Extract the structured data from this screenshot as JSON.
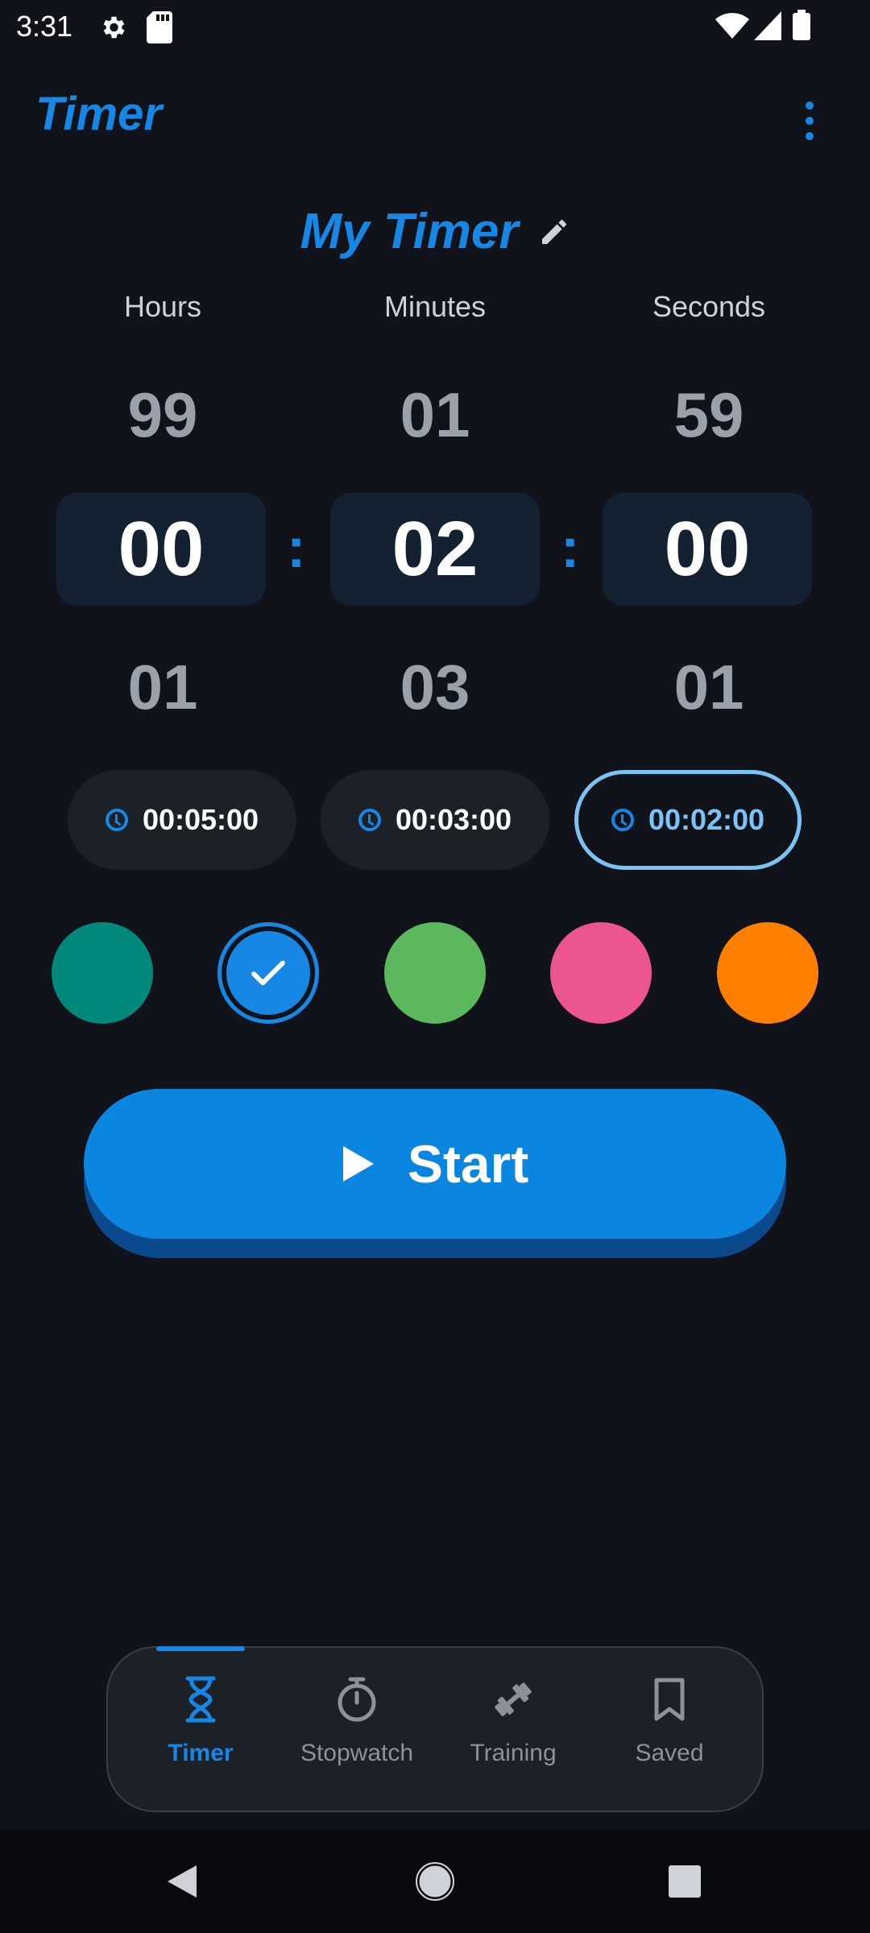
{
  "status_bar": {
    "time": "3:31"
  },
  "app_bar": {
    "title": "Timer"
  },
  "timer_name": "My Timer",
  "columns": [
    {
      "label": "Hours",
      "above": "99",
      "value": "00",
      "below": "01"
    },
    {
      "label": "Minutes",
      "above": "01",
      "value": "02",
      "below": "03"
    },
    {
      "label": "Seconds",
      "above": "59",
      "value": "00",
      "below": "01"
    }
  ],
  "separator": ":",
  "presets": [
    {
      "label": "00:05:00",
      "selected": false
    },
    {
      "label": "00:03:00",
      "selected": false
    },
    {
      "label": "00:02:00",
      "selected": true
    }
  ],
  "colors": [
    {
      "hex": "#00897b",
      "selected": false
    },
    {
      "hex": "#1787e6",
      "selected": true
    },
    {
      "hex": "#5cb85c",
      "selected": false
    },
    {
      "hex": "#ec5592",
      "selected": false
    },
    {
      "hex": "#ff8000",
      "selected": false
    }
  ],
  "start_button": {
    "label": "Start"
  },
  "bottom_nav": [
    {
      "label": "Timer",
      "icon": "hourglass-icon",
      "active": true
    },
    {
      "label": "Stopwatch",
      "icon": "stopwatch-icon",
      "active": false
    },
    {
      "label": "Training",
      "icon": "dumbbell-icon",
      "active": false
    },
    {
      "label": "Saved",
      "icon": "bookmark-icon",
      "active": false
    }
  ],
  "accent_color": "#1787e6"
}
